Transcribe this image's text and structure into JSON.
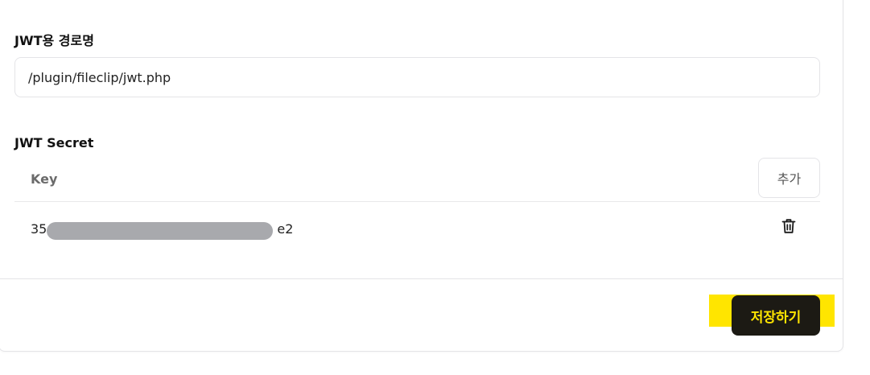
{
  "jwt_path": {
    "label": "JWT용 경로명",
    "value": "/plugin/fileclip/jwt.php"
  },
  "jwt_secret": {
    "label": "JWT Secret",
    "column_header": "Key",
    "add_label": "추가",
    "rows": [
      {
        "key_prefix": "35",
        "key_suffix": "e2",
        "delete_icon": "trash-icon"
      }
    ]
  },
  "footer": {
    "save_label": "저장하기"
  },
  "colors": {
    "save_bg": "#1c1a14",
    "save_text": "#ffe500",
    "highlight": "#ffe500",
    "mask": "#a8a9ad"
  }
}
